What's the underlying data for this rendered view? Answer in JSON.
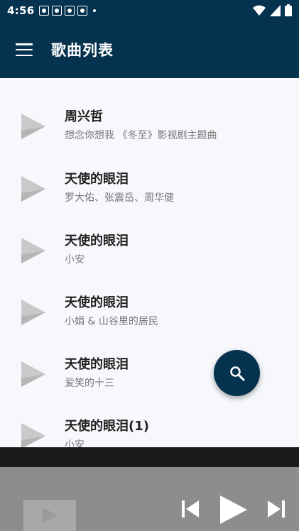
{
  "status_bar": {
    "time": "4:56",
    "notification_icons": [
      "paw-notification-icon",
      "paw-notification-icon",
      "paw-notification-icon",
      "paw-notification-icon"
    ],
    "indicators": [
      "wifi-icon",
      "signal-icon",
      "battery-icon"
    ]
  },
  "app_bar": {
    "title": "歌曲列表",
    "menu_icon": "menu-icon"
  },
  "songs": [
    {
      "title": "周兴哲",
      "artist": "想念你想我 《冬至》影视剧主题曲"
    },
    {
      "title": "天使的眼泪",
      "artist": "罗大佑、张震岳、周华健"
    },
    {
      "title": "天使的眼泪",
      "artist": "小安"
    },
    {
      "title": "天使的眼泪",
      "artist": "小娟 & 山谷里的居民"
    },
    {
      "title": "天使的眼泪",
      "artist": "爱笑的十三"
    },
    {
      "title": "天使的眼泪(1)",
      "artist": "小安"
    }
  ],
  "fab": {
    "icon": "search-icon"
  },
  "player": {
    "controls": [
      "previous-icon",
      "play-icon",
      "next-icon"
    ]
  },
  "colors": {
    "primary": "#05324e",
    "list_background": "#f7f8fc",
    "player_background": "#8d8d8d"
  }
}
